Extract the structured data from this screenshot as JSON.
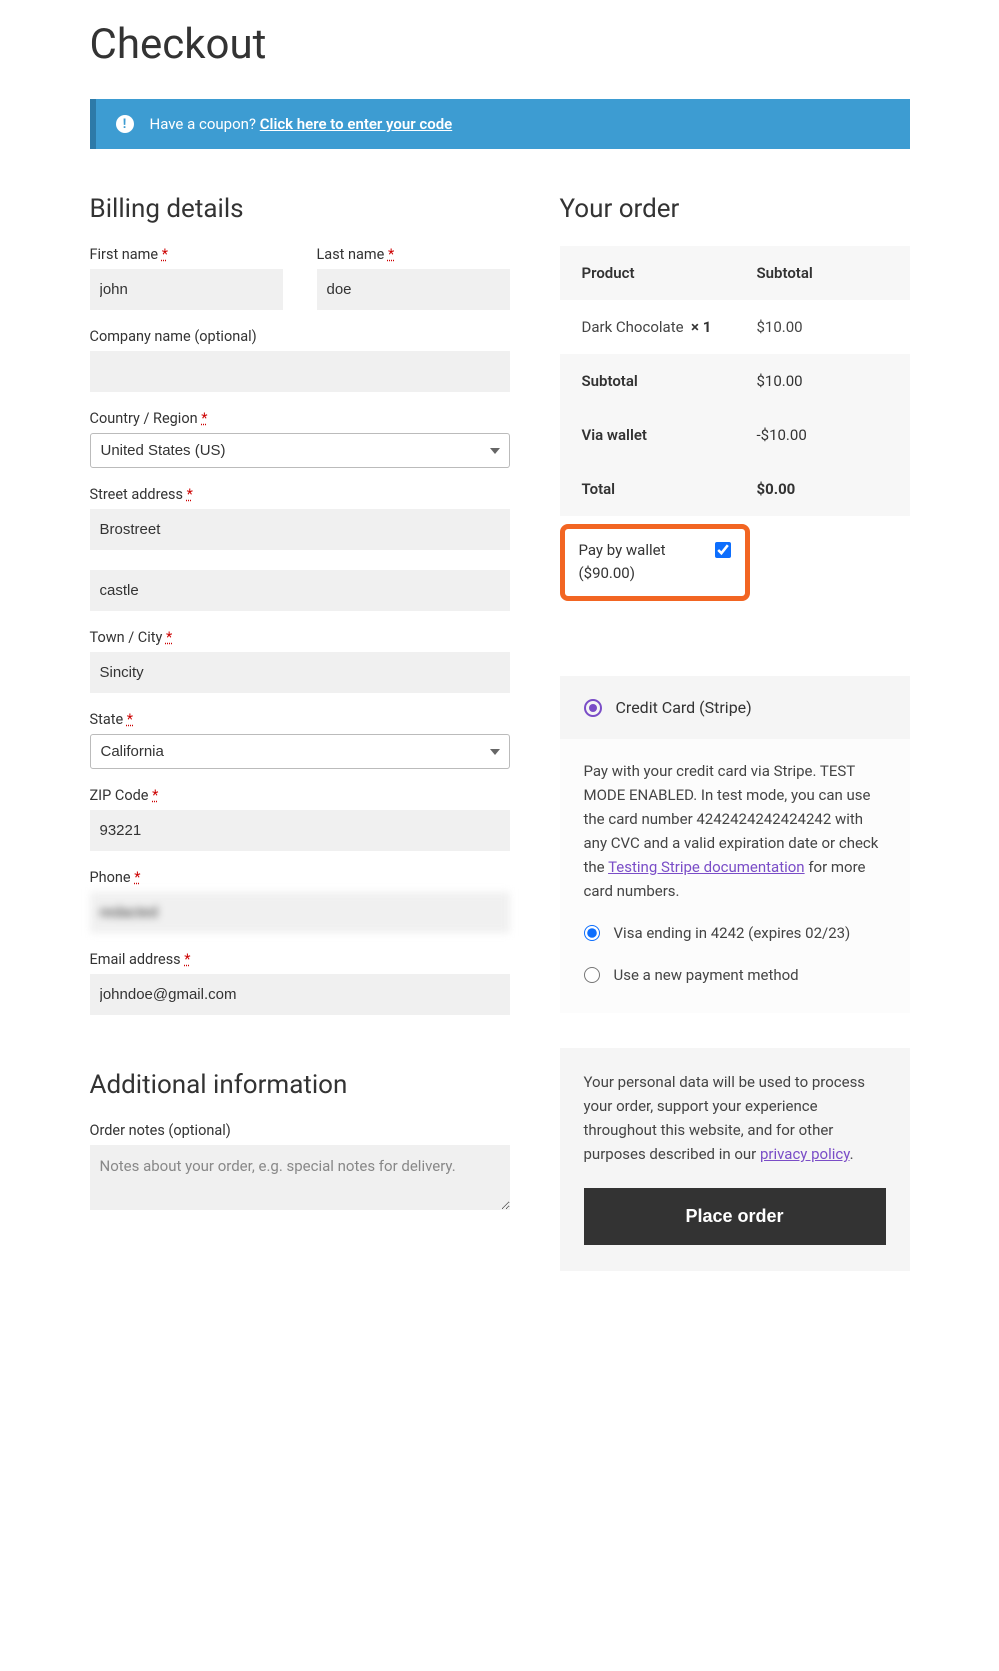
{
  "page_title": "Checkout",
  "notice": {
    "question": "Have a coupon? ",
    "link_text": "Click here to enter your code"
  },
  "billing": {
    "heading": "Billing details",
    "first_name": {
      "label": "First name",
      "value": "john"
    },
    "last_name": {
      "label": "Last name",
      "value": "doe"
    },
    "company": {
      "label": "Company name (optional)",
      "value": ""
    },
    "country": {
      "label": "Country / Region",
      "value": "United States (US)"
    },
    "street": {
      "label": "Street address",
      "value1": "Brostreet",
      "value2": "castle"
    },
    "city": {
      "label": "Town / City",
      "value": "Sincity"
    },
    "state": {
      "label": "State",
      "value": "California"
    },
    "zip": {
      "label": "ZIP Code",
      "value": "93221"
    },
    "phone": {
      "label": "Phone",
      "value": "redacted"
    },
    "email": {
      "label": "Email address",
      "value": "johndoe@gmail.com"
    },
    "required": "*"
  },
  "additional": {
    "heading": "Additional information",
    "notes_label": "Order notes (optional)",
    "notes_placeholder": "Notes about your order, e.g. special notes for delivery."
  },
  "order": {
    "heading": "Your order",
    "col_product": "Product",
    "col_subtotal": "Subtotal",
    "item": {
      "name": "Dark Chocolate",
      "qty": "× 1",
      "price": "$10.00"
    },
    "subtotal": {
      "label": "Subtotal",
      "value": "$10.00"
    },
    "via_wallet": {
      "label": "Via wallet",
      "value": "-$10.00"
    },
    "total": {
      "label": "Total",
      "value": "$0.00"
    },
    "wallet": {
      "label": "Pay by wallet",
      "balance": "($90.00)"
    }
  },
  "payment": {
    "method_label": "Credit Card (Stripe)",
    "desc_prefix": "Pay with your credit card via Stripe. TEST MODE ENABLED. In test mode, you can use the card number 4242424242424242 with any CVC and a valid expiration date or check the ",
    "desc_link": "Testing Stripe documentation",
    "desc_suffix": " for more card numbers.",
    "saved_card": "Visa ending in 4242 (expires 02/23)",
    "new_method": "Use a new payment method"
  },
  "footer": {
    "text_prefix": "Your personal data will be used to process your order, support your experience throughout this website, and for other purposes described in our ",
    "link": "privacy policy",
    "text_suffix": ".",
    "button": "Place order"
  }
}
